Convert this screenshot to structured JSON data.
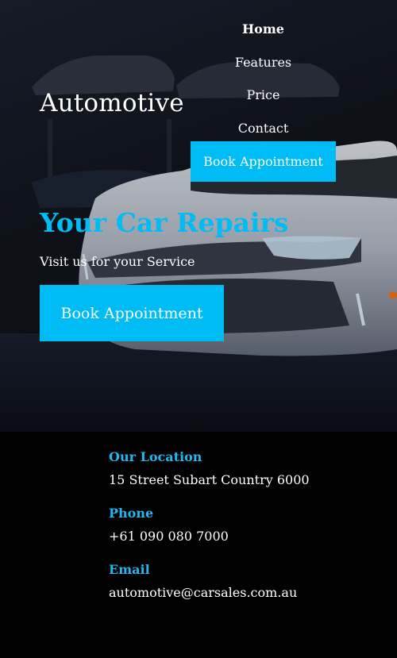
{
  "brand": {
    "name": "Automotive"
  },
  "nav": {
    "items": [
      {
        "label": "Home",
        "active": true
      },
      {
        "label": "Features",
        "active": false
      },
      {
        "label": "Price",
        "active": false
      },
      {
        "label": "Contact",
        "active": false
      }
    ],
    "cta_label": "Book Appointment"
  },
  "hero": {
    "headline": "Your Car Repairs",
    "tagline": "Visit us for your Service",
    "cta_label": "Book Appointment"
  },
  "contact": {
    "location_heading": "Our Location",
    "location_text": "15 Street Subart Country 6000",
    "phone_heading": "Phone",
    "phone_text": "+61 090 080 7000",
    "email_heading": "Email",
    "email_text": "automotive@carsales.com.au"
  },
  "colors": {
    "accent": "#00bcf5",
    "background": "#000000",
    "text": "#ffffff"
  }
}
